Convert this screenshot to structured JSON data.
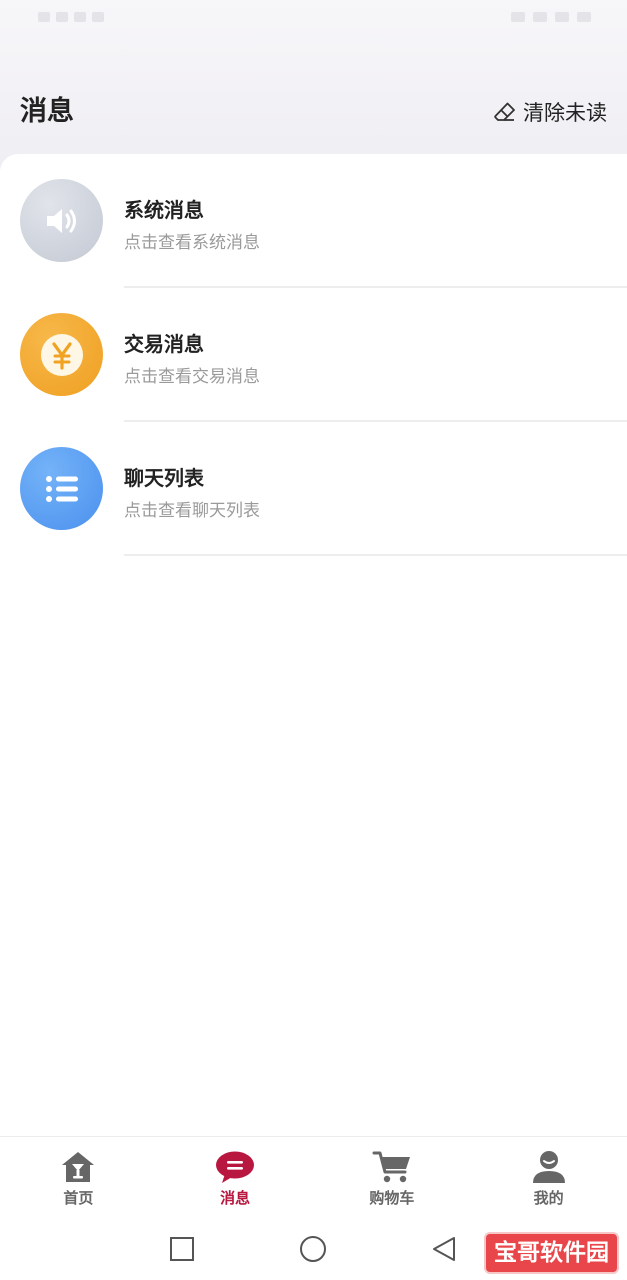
{
  "header": {
    "title": "消息",
    "clear_unread_label": "清除未读",
    "clear_icon": "eraser-icon"
  },
  "messages": [
    {
      "title": "系统消息",
      "subtitle": "点击查看系统消息",
      "icon": "speaker-icon",
      "color": "#c7ccd6"
    },
    {
      "title": "交易消息",
      "subtitle": "点击查看交易消息",
      "icon": "yen-icon",
      "color": "#f2a52a"
    },
    {
      "title": "聊天列表",
      "subtitle": "点击查看聊天列表",
      "icon": "list-icon",
      "color": "#5a9df2"
    }
  ],
  "tabbar": {
    "active_index": 1,
    "active_color": "#b8173f",
    "items": [
      {
        "label": "首页",
        "icon": "home-icon"
      },
      {
        "label": "消息",
        "icon": "chat-bubble-icon"
      },
      {
        "label": "购物车",
        "icon": "cart-icon"
      },
      {
        "label": "我的",
        "icon": "user-icon"
      }
    ]
  },
  "system_nav": {
    "icons": [
      "square-icon",
      "circle-icon",
      "triangle-back-icon"
    ]
  },
  "watermark": {
    "text": "宝哥软件园"
  }
}
